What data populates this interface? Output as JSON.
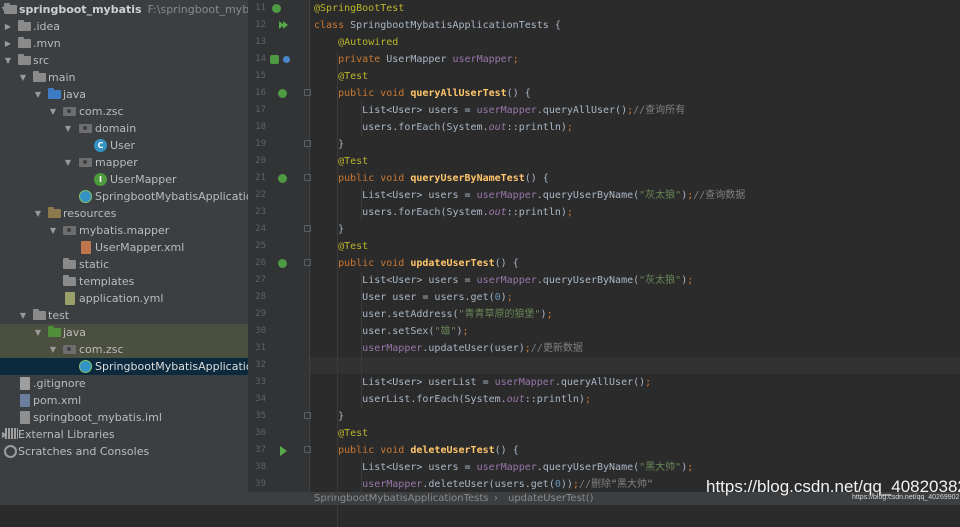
{
  "project_tree": {
    "project_name": "springboot_mybatis",
    "project_path": "F:\\springboot_mybatis\\sp",
    "items": [
      {
        "label": "springboot_mybatis",
        "path": "F:\\springboot_mybatis\\sp",
        "icon": "folder-icon",
        "expanded": true
      },
      {
        "label": ".idea",
        "icon": "folder-icon",
        "expanded": false
      },
      {
        "label": ".mvn",
        "icon": "folder-icon",
        "expanded": false
      },
      {
        "label": "src",
        "icon": "folder-icon",
        "expanded": true
      },
      {
        "label": "main",
        "icon": "folder-icon",
        "expanded": true
      },
      {
        "label": "java",
        "icon": "source-folder-icon",
        "expanded": true
      },
      {
        "label": "com.zsc",
        "icon": "package-icon",
        "expanded": true
      },
      {
        "label": "domain",
        "icon": "package-icon",
        "expanded": true
      },
      {
        "label": "User",
        "icon": "class-icon"
      },
      {
        "label": "mapper",
        "icon": "package-icon",
        "expanded": true
      },
      {
        "label": "UserMapper",
        "icon": "interface-icon"
      },
      {
        "label": "SpringbootMybatisApplication",
        "icon": "spring-boot-class-icon"
      },
      {
        "label": "resources",
        "icon": "resources-folder-icon",
        "expanded": true
      },
      {
        "label": "mybatis.mapper",
        "icon": "package-icon",
        "expanded": true
      },
      {
        "label": "UserMapper.xml",
        "icon": "xml-file-icon"
      },
      {
        "label": "static",
        "icon": "folder-icon"
      },
      {
        "label": "templates",
        "icon": "folder-icon"
      },
      {
        "label": "application.yml",
        "icon": "yml-file-icon"
      },
      {
        "label": "test",
        "icon": "folder-icon",
        "expanded": true
      },
      {
        "label": "java",
        "icon": "test-source-folder-icon",
        "expanded": true
      },
      {
        "label": "com.zsc",
        "icon": "package-icon",
        "expanded": true
      },
      {
        "label": "SpringbootMybatisApplicationT",
        "icon": "spring-boot-test-class-icon"
      },
      {
        "label": ".gitignore",
        "icon": "gitignore-file-icon"
      },
      {
        "label": "pom.xml",
        "icon": "maven-file-icon"
      },
      {
        "label": "springboot_mybatis.iml",
        "icon": "iml-file-icon"
      },
      {
        "label": "External Libraries",
        "icon": "library-icon",
        "expanded": false
      },
      {
        "label": "Scratches and Consoles",
        "icon": "scratches-icon",
        "expanded": false
      }
    ]
  },
  "editor": {
    "line_numbers": [
      "11",
      "12",
      "13",
      "14",
      "15",
      "16",
      "17",
      "18",
      "19",
      "20",
      "21",
      "22",
      "23",
      "24",
      "25",
      "26",
      "27",
      "28",
      "29",
      "30",
      "31",
      "32",
      "33",
      "34",
      "35",
      "36",
      "37",
      "38",
      "39"
    ],
    "current_line": "32",
    "lines": [
      [
        [
          "an",
          "@SpringBootTest"
        ]
      ],
      [
        [
          "kw",
          "class "
        ],
        [
          "cls",
          "SpringbootMybatisApplicationTests {"
        ]
      ],
      [
        [
          "pad",
          "    "
        ],
        [
          "an",
          "@Autowired"
        ]
      ],
      [
        [
          "pad",
          "    "
        ],
        [
          "kw",
          "private "
        ],
        [
          "cls",
          "UserMapper "
        ],
        [
          "fld",
          "userMapper"
        ],
        [
          "kw",
          ";"
        ]
      ],
      [
        [
          "pad",
          "    "
        ],
        [
          "an",
          "@Test"
        ]
      ],
      [
        [
          "pad",
          "    "
        ],
        [
          "kw",
          "public void "
        ],
        [
          "fn",
          "queryAllUserTest"
        ],
        [
          "cls",
          "() {"
        ]
      ],
      [
        [
          "pad",
          "        "
        ],
        [
          "cls",
          "List<User> users = "
        ],
        [
          "fld",
          "userMapper"
        ],
        [
          "cls",
          ".queryAllUser()"
        ],
        [
          "kw",
          ";"
        ],
        [
          "cm",
          "//查询所有"
        ]
      ],
      [
        [
          "pad",
          "        "
        ],
        [
          "cls",
          "users.forEach(System."
        ],
        [
          "it",
          "out"
        ],
        [
          "cls",
          "::println)"
        ],
        [
          "kw",
          ";"
        ]
      ],
      [
        [
          "pad",
          "    "
        ],
        [
          "cls",
          "}"
        ]
      ],
      [
        [
          "pad",
          "    "
        ],
        [
          "an",
          "@Test"
        ]
      ],
      [
        [
          "pad",
          "    "
        ],
        [
          "kw",
          "public void "
        ],
        [
          "fn",
          "queryUserByNameTest"
        ],
        [
          "cls",
          "() {"
        ]
      ],
      [
        [
          "pad",
          "        "
        ],
        [
          "cls",
          "List<User> users = "
        ],
        [
          "fld",
          "userMapper"
        ],
        [
          "cls",
          ".queryUserByName("
        ],
        [
          "st",
          "\"灰太狼\""
        ],
        [
          "cls",
          ")"
        ],
        [
          "kw",
          ";"
        ],
        [
          "cm",
          "//查询数据"
        ]
      ],
      [
        [
          "pad",
          "        "
        ],
        [
          "cls",
          "users.forEach(System."
        ],
        [
          "it",
          "out"
        ],
        [
          "cls",
          "::println)"
        ],
        [
          "kw",
          ";"
        ]
      ],
      [
        [
          "pad",
          "    "
        ],
        [
          "cls",
          "}"
        ]
      ],
      [
        [
          "pad",
          "    "
        ],
        [
          "an",
          "@Test"
        ]
      ],
      [
        [
          "pad",
          "    "
        ],
        [
          "kw",
          "public void "
        ],
        [
          "fn",
          "updateUserTest"
        ],
        [
          "cls",
          "() {"
        ]
      ],
      [
        [
          "pad",
          "        "
        ],
        [
          "cls",
          "List<User> users = "
        ],
        [
          "fld",
          "userMapper"
        ],
        [
          "cls",
          ".queryUserByName("
        ],
        [
          "st",
          "\"灰太狼\""
        ],
        [
          "cls",
          ")"
        ],
        [
          "kw",
          ";"
        ]
      ],
      [
        [
          "pad",
          "        "
        ],
        [
          "cls",
          "User user = users.get("
        ],
        [
          "num",
          "0"
        ],
        [
          "cls",
          ")"
        ],
        [
          "kw",
          ";"
        ]
      ],
      [
        [
          "pad",
          "        "
        ],
        [
          "cls",
          "user.setAddress("
        ],
        [
          "st",
          "\"青青草原的狼堡\""
        ],
        [
          "cls",
          ")"
        ],
        [
          "kw",
          ";"
        ]
      ],
      [
        [
          "pad",
          "        "
        ],
        [
          "cls",
          "user.setSex("
        ],
        [
          "st",
          "\"雄\""
        ],
        [
          "cls",
          ")"
        ],
        [
          "kw",
          ";"
        ]
      ],
      [
        [
          "pad",
          "        "
        ],
        [
          "fld",
          "userMapper"
        ],
        [
          "cls",
          ".updateUser(user)"
        ],
        [
          "kw",
          ";"
        ],
        [
          "cm",
          "//更新数据"
        ]
      ],
      [],
      [
        [
          "pad",
          "        "
        ],
        [
          "cls",
          "List<User> userList = "
        ],
        [
          "fld",
          "userMapper"
        ],
        [
          "cls",
          ".queryAllUser()"
        ],
        [
          "kw",
          ";"
        ]
      ],
      [
        [
          "pad",
          "        "
        ],
        [
          "cls",
          "userList.forEach(System."
        ],
        [
          "it",
          "out"
        ],
        [
          "cls",
          "::println)"
        ],
        [
          "kw",
          ";"
        ]
      ],
      [
        [
          "pad",
          "    "
        ],
        [
          "cls",
          "}"
        ]
      ],
      [
        [
          "pad",
          "    "
        ],
        [
          "an",
          "@Test"
        ]
      ],
      [
        [
          "pad",
          "    "
        ],
        [
          "kw",
          "public void "
        ],
        [
          "fn",
          "deleteUserTest"
        ],
        [
          "cls",
          "() {"
        ]
      ],
      [
        [
          "pad",
          "        "
        ],
        [
          "cls",
          "List<User> users = "
        ],
        [
          "fld",
          "userMapper"
        ],
        [
          "cls",
          ".queryUserByName("
        ],
        [
          "st",
          "\"黑大帅\""
        ],
        [
          "cls",
          ")"
        ],
        [
          "kw",
          ";"
        ]
      ],
      [
        [
          "pad",
          "        "
        ],
        [
          "fld",
          "userMapper"
        ],
        [
          "cls",
          ".deleteUser(users.get("
        ],
        [
          "num",
          "0"
        ],
        [
          "cls",
          "))"
        ],
        [
          "kw",
          ";"
        ],
        [
          "cm",
          "//删除“黑大帅“"
        ]
      ]
    ]
  },
  "breadcrumb": {
    "class_name": "SpringbootMybatisApplicationTests",
    "separator": "›",
    "method_name": "updateUserTest()"
  },
  "watermark": {
    "url": "https://blog.csdn.net/qq_40820382",
    "small": "https://blog.csdn.net/qq_40269902"
  },
  "colors": {
    "editor_bg": "#2b2b2b",
    "sidebar_bg": "#3c3f41",
    "keyword": "#cc7832",
    "annotation": "#bbb529",
    "string": "#6a8759",
    "field": "#9876aa",
    "method_decl": "#ffc66d",
    "comment": "#808080"
  }
}
